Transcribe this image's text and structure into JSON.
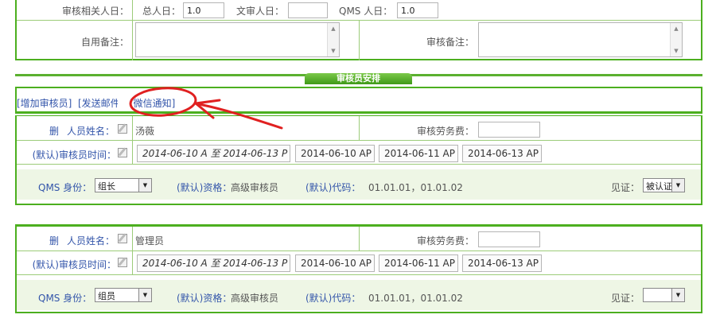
{
  "audit_days": {
    "label": "审核相关人日：",
    "total_label": "总人日：",
    "total_value": "1.0",
    "doc_label": "文审人日：",
    "doc_value": "",
    "qms_label": "QMS 人日：",
    "qms_value": "1.0"
  },
  "remarks": {
    "use_label": "自用备注：",
    "audit_label": "审核备注："
  },
  "section": {
    "title": "审核员安排"
  },
  "actions": {
    "add_auditor": "[增加审核员]",
    "send_mail": "[发送邮件]",
    "wechat_notify": "[微信通知]"
  },
  "auditors": [
    {
      "delete_label": "删",
      "name_label": "人员姓名：",
      "name": "汤薇",
      "fee_label": "审核劳务费：",
      "fee_value": "",
      "time_label": "(默认)审核员时间：",
      "time_range": "2014-06-10 A 至 2014-06-13 P",
      "dates": [
        "2014-06-10 AP",
        "2014-06-11 AP",
        "2014-06-13 AP"
      ],
      "qms_role_label": "QMS 身份：",
      "qms_role": "组长",
      "qual_label": "(默认)资格：",
      "qual_value": "高级审核员",
      "code_label": "(默认)代码：",
      "code_value": "01.01.01，01.01.02",
      "witness_label": "见证：",
      "witness_value": "被认证"
    },
    {
      "delete_label": "删",
      "name_label": "人员姓名：",
      "name": "管理员",
      "fee_label": "审核劳务费：",
      "fee_value": "",
      "time_label": "(默认)审核员时间：",
      "time_range": "2014-06-10 A 至 2014-06-13 P",
      "dates": [
        "2014-06-10 AP",
        "2014-06-11 AP",
        "2014-06-13 AP"
      ],
      "qms_role_label": "QMS 身份：",
      "qms_role": "组员",
      "qual_label": "(默认)资格：",
      "qual_value": "高级审核员",
      "code_label": "(默认)代码：",
      "code_value": "01.01.01，01.01.02",
      "witness_label": "见证：",
      "witness_value": ""
    }
  ],
  "colors": {
    "border_green": "#4caf1f",
    "annotation_red": "#e02020",
    "link_blue": "#3355aa"
  }
}
